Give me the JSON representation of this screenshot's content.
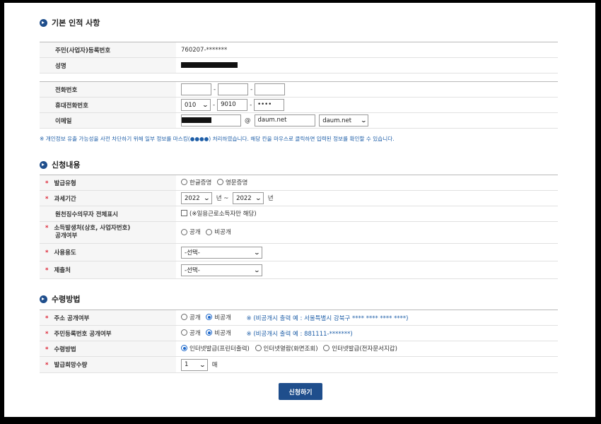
{
  "section1": {
    "title": "기본 인적 사항",
    "rows": {
      "rrn_label": "주민(사업자)등록번호",
      "rrn_value": "760207-*******",
      "name_label": "성명"
    }
  },
  "contact": {
    "phone_label": "전화번호",
    "phone_values": [
      "",
      "",
      ""
    ],
    "mobile_label": "휴대전화번호",
    "mobile_prefix": "010",
    "mobile_mid": "9010",
    "mobile_last": "••••",
    "email_label": "이메일",
    "email_at": "@",
    "email_domain": "daum.net",
    "email_domain_select": "daum.net"
  },
  "notice": "※ 개인정보 유출 가능성을 사전 차단하기 위해 일부 정보를 마스킹(●●●●) 처리하였습니다. 해당 칸을 마우스로 클릭하면 입력된 정보를 확인할 수 있습니다.",
  "section2": {
    "title": "신청내용",
    "issue_type_label": "발급유형",
    "issue_type_options": [
      "한글증명",
      "영문증명"
    ],
    "period_label": "과세기간",
    "period_from": "2022",
    "period_from_unit": "년 ~",
    "period_to": "2022",
    "period_to_unit": "년",
    "withholding_label": "원천징수의무자 전체표시",
    "withholding_note": "(※일용근로소득자만 해당)",
    "income_label_line1": "소득발생처(상호, 사업자번호)",
    "income_label_line2": "공개여부",
    "income_options": [
      "공개",
      "비공개"
    ],
    "purpose_label": "사용용도",
    "purpose_select": "-선택-",
    "submit_to_label": "제출처",
    "submit_to_select": "-선택-"
  },
  "section3": {
    "title": "수령방법",
    "addr_label": "주소 공개여부",
    "addr_options": [
      "공개",
      "비공개"
    ],
    "addr_note": "※ (비공개시 출력 예 : 서울특별시 강북구 **** **** **** ****)",
    "rrn_pub_label": "주민등록번호 공개여부",
    "rrn_pub_options": [
      "공개",
      "비공개"
    ],
    "rrn_pub_note": "※ (비공개시 출력 예 : 881111-*******)",
    "receive_label": "수령방법",
    "receive_options": [
      "인터넷발급(프린터출력)",
      "인터넷열람(화면조회)",
      "인터넷발급(전자문서지갑)"
    ],
    "qty_label": "발급희망수량",
    "qty_value": "1",
    "qty_unit": "매"
  },
  "submit_label": "신청하기",
  "colors": {
    "accent": "#1f4e8c",
    "note": "#1f5fa8",
    "required": "#dd2233"
  }
}
